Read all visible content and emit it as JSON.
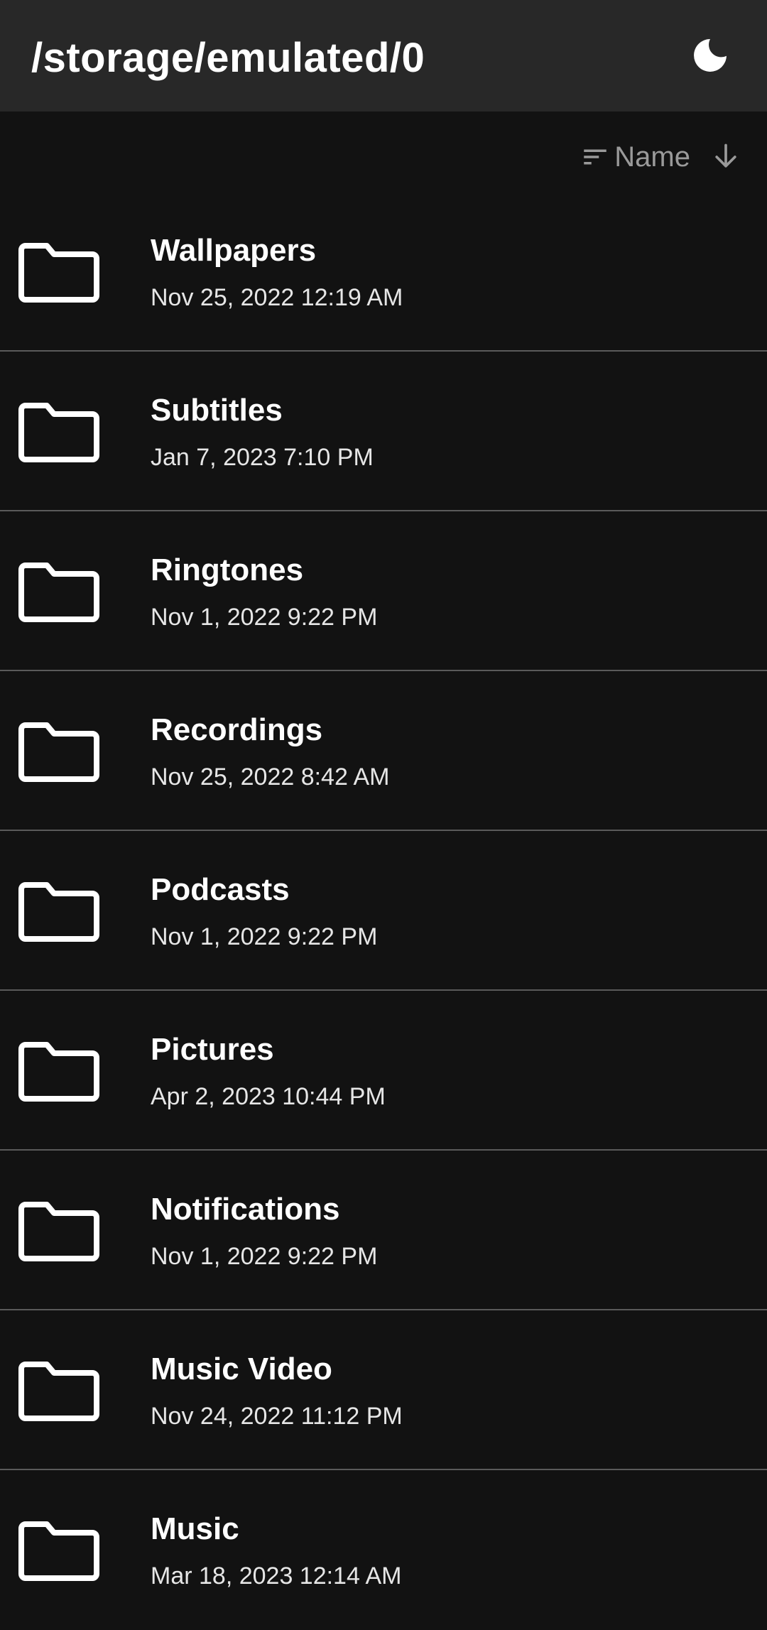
{
  "appbar": {
    "title": "/storage/emulated/0",
    "theme_icon": "moon-icon"
  },
  "sort": {
    "icon": "sort-icon",
    "label": "Name",
    "direction_icon": "arrow-down-icon"
  },
  "items": [
    {
      "name": "Wallpapers",
      "date": "Nov 25, 2022 12:19 AM",
      "icon": "folder-icon"
    },
    {
      "name": "Subtitles",
      "date": "Jan 7, 2023 7:10 PM",
      "icon": "folder-icon"
    },
    {
      "name": "Ringtones",
      "date": "Nov 1, 2022 9:22 PM",
      "icon": "folder-icon"
    },
    {
      "name": "Recordings",
      "date": "Nov 25, 2022 8:42 AM",
      "icon": "folder-icon"
    },
    {
      "name": "Podcasts",
      "date": "Nov 1, 2022 9:22 PM",
      "icon": "folder-icon"
    },
    {
      "name": "Pictures",
      "date": "Apr 2, 2023 10:44 PM",
      "icon": "folder-icon"
    },
    {
      "name": "Notifications",
      "date": "Nov 1, 2022 9:22 PM",
      "icon": "folder-icon"
    },
    {
      "name": "Music Video",
      "date": "Nov 24, 2022 11:12 PM",
      "icon": "folder-icon"
    },
    {
      "name": "Music",
      "date": "Mar 18, 2023 12:14 AM",
      "icon": "folder-icon"
    }
  ],
  "colors": {
    "background": "#121212",
    "appbar": "#282828",
    "divider": "#5a5a5a",
    "secondary_text": "#9a9a9a"
  }
}
